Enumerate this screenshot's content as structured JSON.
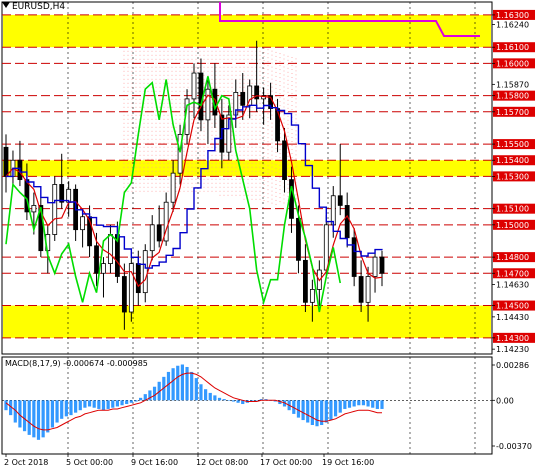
{
  "window": {
    "title": "EURUSD,H4"
  },
  "main_axis": {
    "ticks": [
      {
        "value": 1.163,
        "label": "1.16300",
        "highlight": true
      },
      {
        "value": 1.1624,
        "label": "1.16240",
        "highlight": false
      },
      {
        "value": 1.161,
        "label": "1.16100",
        "highlight": true
      },
      {
        "value": 1.16,
        "label": "1.16000",
        "highlight": true
      },
      {
        "value": 1.1587,
        "label": "1.15870",
        "highlight": false
      },
      {
        "value": 1.158,
        "label": "1.15800",
        "highlight": true
      },
      {
        "value": 1.157,
        "label": "1.15700",
        "highlight": true
      },
      {
        "value": 1.155,
        "label": "1.15500",
        "highlight": true
      },
      {
        "value": 1.154,
        "label": "1.15400",
        "highlight": true
      },
      {
        "value": 1.153,
        "label": "1.15300",
        "highlight": true
      },
      {
        "value": 1.151,
        "label": "1.15100",
        "highlight": true
      },
      {
        "value": 1.15,
        "label": "1.15000",
        "highlight": true
      },
      {
        "value": 1.148,
        "label": "1.14800",
        "highlight": true
      },
      {
        "value": 1.147,
        "label": "1.14700",
        "highlight": true
      },
      {
        "value": 1.1463,
        "label": "1.14630",
        "highlight": false
      },
      {
        "value": 1.145,
        "label": "1.14500",
        "highlight": true
      },
      {
        "value": 1.1443,
        "label": "1.14430",
        "highlight": false
      },
      {
        "value": 1.143,
        "label": "1.14300",
        "highlight": true
      },
      {
        "value": 1.1423,
        "label": "1.14230",
        "highlight": false
      }
    ],
    "levels": [
      1.163,
      1.161,
      1.16,
      1.158,
      1.157,
      1.155,
      1.154,
      1.153,
      1.151,
      1.15,
      1.148,
      1.147,
      1.145,
      1.143
    ],
    "zones": [
      {
        "from": 1.161,
        "to": 1.163
      },
      {
        "from": 1.153,
        "to": 1.154
      },
      {
        "from": 1.143,
        "to": 1.145
      }
    ]
  },
  "macd": {
    "title": "MACD(8,17,9) -0.000674 -0.000985",
    "axis_labels": [
      {
        "value": 0.00286,
        "label": "0.00286"
      },
      {
        "value": 0.0,
        "label": "0.00"
      },
      {
        "value": -0.0037,
        "label": "-0.00370"
      }
    ],
    "histogram": [
      -0.0008,
      -0.0012,
      -0.0018,
      -0.0022,
      -0.0025,
      -0.0028,
      -0.003,
      -0.0032,
      -0.003,
      -0.0026,
      -0.0022,
      -0.0018,
      -0.0015,
      -0.0013,
      -0.0012,
      -0.001,
      -0.0008,
      -0.0006,
      -0.0005,
      -0.0006,
      -0.0007,
      -0.0008,
      -0.0007,
      -0.0006,
      -0.0005,
      -0.0004,
      -0.0003,
      -0.0002,
      -0.0001,
      0.0002,
      0.0005,
      0.0008,
      0.0011,
      0.0015,
      0.0019,
      0.0023,
      0.0026,
      0.0028,
      0.0029,
      0.0027,
      0.0023,
      0.0018,
      0.0013,
      0.0009,
      0.0006,
      0.0004,
      0.0002,
      0.0001,
      0.0,
      -0.0001,
      -0.0002,
      -0.0003,
      -0.0002,
      -0.0001,
      0.0,
      0.0001,
      0.0001,
      0.0,
      -0.0001,
      -0.0003,
      -0.0005,
      -0.0008,
      -0.0011,
      -0.0014,
      -0.0016,
      -0.0018,
      -0.002,
      -0.0021,
      -0.002,
      -0.0018,
      -0.0016,
      -0.0013,
      -0.001,
      -0.0007,
      -0.0006,
      -0.0005,
      -0.0004,
      -0.0004,
      -0.0005,
      -0.0006,
      -0.0007,
      -0.0007
    ],
    "signal": [
      -0.0002,
      -0.0005,
      -0.0008,
      -0.0012,
      -0.0015,
      -0.0018,
      -0.0021,
      -0.0023,
      -0.0024,
      -0.0024,
      -0.0023,
      -0.0022,
      -0.002,
      -0.0018,
      -0.0016,
      -0.0014,
      -0.0013,
      -0.0011,
      -0.001,
      -0.0009,
      -0.0008,
      -0.0008,
      -0.0008,
      -0.0007,
      -0.0007,
      -0.0006,
      -0.0005,
      -0.0004,
      -0.0003,
      -0.0002,
      0.0,
      0.0002,
      0.0004,
      0.0007,
      0.001,
      0.0013,
      0.0016,
      0.0019,
      0.0021,
      0.0022,
      0.0022,
      0.0021,
      0.0019,
      0.0016,
      0.0013,
      0.001,
      0.0008,
      0.0006,
      0.0004,
      0.0002,
      0.0001,
      0.0,
      -0.0001,
      -0.0001,
      -0.0001,
      0.0,
      0.0,
      0.0,
      0.0,
      -0.0001,
      -0.0002,
      -0.0004,
      -0.0006,
      -0.0008,
      -0.001,
      -0.0012,
      -0.0014,
      -0.0016,
      -0.0017,
      -0.0017,
      -0.0016,
      -0.0015,
      -0.0013,
      -0.0011,
      -0.001,
      -0.0009,
      -0.0008,
      -0.0008,
      -0.0008,
      -0.0009,
      -0.001,
      -0.001
    ]
  },
  "time_axis": {
    "labels": [
      "2 Oct 2018",
      "5 Oct 00:00",
      "9 Oct 16:00",
      "12 Oct 08:00",
      "17 Oct 00:00",
      "19 Oct 16:00"
    ]
  },
  "colors": {
    "zone": "#ffff00",
    "level_line": "#cc0000",
    "bull_candle": "#ffffff",
    "bear_candle": "#000000",
    "blue_line": "#0000cc",
    "red_line": "#dd0000",
    "green_line": "#00dd00",
    "cloud_dots": "#ff9999",
    "magenta_line": "#dd00dd",
    "macd_hist": "#3399ff",
    "macd_signal": "#dd0000",
    "axis_highlight": "#dd0000"
  },
  "chart_data": {
    "type": "candlestick",
    "symbol": "EURUSD",
    "timeframe": "H4",
    "ylim": [
      1.142,
      1.1638
    ],
    "candles": [
      [
        1.1548,
        1.1556,
        1.152,
        1.153
      ],
      [
        1.153,
        1.1546,
        1.1524,
        1.154
      ],
      [
        1.154,
        1.1552,
        1.1524,
        1.1528
      ],
      [
        1.1528,
        1.1538,
        1.1503,
        1.1508
      ],
      [
        1.1508,
        1.152,
        1.1494,
        1.1512
      ],
      [
        1.1512,
        1.1517,
        1.148,
        1.1484
      ],
      [
        1.1484,
        1.15,
        1.147,
        1.1494
      ],
      [
        1.1494,
        1.153,
        1.149,
        1.1525
      ],
      [
        1.1525,
        1.1544,
        1.151,
        1.1514
      ],
      [
        1.1514,
        1.1527,
        1.1505,
        1.1522
      ],
      [
        1.1522,
        1.1525,
        1.149,
        1.1497
      ],
      [
        1.1497,
        1.151,
        1.1486,
        1.1505
      ],
      [
        1.1505,
        1.1512,
        1.148,
        1.1487
      ],
      [
        1.1487,
        1.1495,
        1.1462,
        1.147
      ],
      [
        1.147,
        1.148,
        1.1455,
        1.1476
      ],
      [
        1.1476,
        1.15,
        1.147,
        1.1494
      ],
      [
        1.1494,
        1.1502,
        1.1464,
        1.1468
      ],
      [
        1.1468,
        1.1476,
        1.1435,
        1.1446
      ],
      [
        1.1446,
        1.148,
        1.144,
        1.1476
      ],
      [
        1.1476,
        1.1484,
        1.145,
        1.1458
      ],
      [
        1.1458,
        1.1488,
        1.1452,
        1.1484
      ],
      [
        1.1484,
        1.1506,
        1.1478,
        1.15
      ],
      [
        1.15,
        1.1512,
        1.1486,
        1.149
      ],
      [
        1.149,
        1.152,
        1.1487,
        1.1514
      ],
      [
        1.1514,
        1.154,
        1.1508,
        1.1532
      ],
      [
        1.1532,
        1.1562,
        1.1525,
        1.1556
      ],
      [
        1.1556,
        1.1584,
        1.155,
        1.1578
      ],
      [
        1.1578,
        1.16,
        1.1566,
        1.1594
      ],
      [
        1.1594,
        1.1603,
        1.1558,
        1.1565
      ],
      [
        1.1565,
        1.159,
        1.155,
        1.1584
      ],
      [
        1.1584,
        1.16,
        1.156,
        1.1568
      ],
      [
        1.1568,
        1.1578,
        1.1535,
        1.1545
      ],
      [
        1.1545,
        1.1574,
        1.154,
        1.1568
      ],
      [
        1.1568,
        1.159,
        1.156,
        1.1582
      ],
      [
        1.1582,
        1.1594,
        1.1565,
        1.1574
      ],
      [
        1.1574,
        1.159,
        1.1566,
        1.1586
      ],
      [
        1.1586,
        1.1614,
        1.157,
        1.1578
      ],
      [
        1.1578,
        1.1585,
        1.1562,
        1.158
      ],
      [
        1.158,
        1.1588,
        1.1565,
        1.1572
      ],
      [
        1.1572,
        1.1578,
        1.1545,
        1.1552
      ],
      [
        1.1552,
        1.156,
        1.152,
        1.1528
      ],
      [
        1.1528,
        1.1536,
        1.1495,
        1.1504
      ],
      [
        1.1504,
        1.1512,
        1.147,
        1.1478
      ],
      [
        1.1478,
        1.1488,
        1.1446,
        1.1452
      ],
      [
        1.1452,
        1.1466,
        1.144,
        1.146
      ],
      [
        1.146,
        1.1478,
        1.145,
        1.1472
      ],
      [
        1.1472,
        1.1506,
        1.1468,
        1.15
      ],
      [
        1.15,
        1.1524,
        1.1492,
        1.1518
      ],
      [
        1.1518,
        1.155,
        1.1506,
        1.1512
      ],
      [
        1.1512,
        1.152,
        1.1486,
        1.1492
      ],
      [
        1.1492,
        1.1498,
        1.1462,
        1.1468
      ],
      [
        1.1468,
        1.1478,
        1.1446,
        1.1452
      ],
      [
        1.1452,
        1.1474,
        1.144,
        1.1468
      ],
      [
        1.1468,
        1.1485,
        1.1458,
        1.148
      ],
      [
        1.148,
        1.1484,
        1.1462,
        1.147
      ]
    ]
  }
}
